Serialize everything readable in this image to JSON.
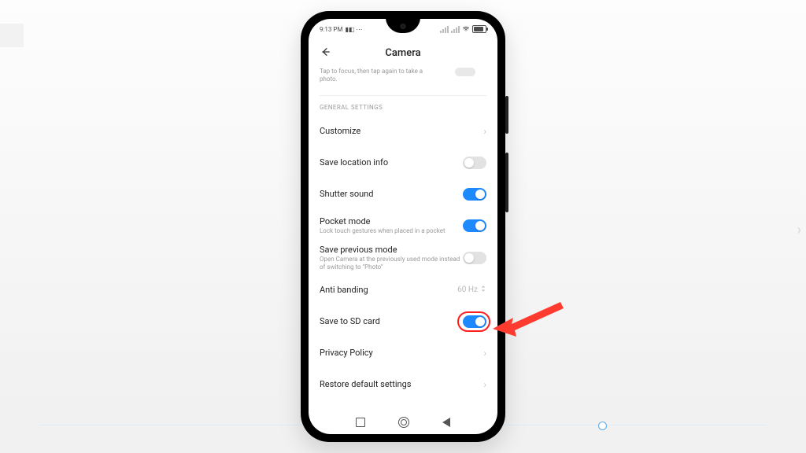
{
  "status": {
    "time": "9:13 PM",
    "icons_left": "▮◧ ⋯"
  },
  "header": {
    "title": "Camera"
  },
  "clipped": {
    "line1": "Tap to focus, then tap again to take a",
    "line2": "photo."
  },
  "section_title": "GENERAL SETTINGS",
  "rows": {
    "customize": {
      "label": "Customize"
    },
    "location": {
      "label": "Save location info",
      "on": false
    },
    "shutter": {
      "label": "Shutter sound",
      "on": true
    },
    "pocket": {
      "label": "Pocket mode",
      "sub": "Lock touch gestures when placed in a pocket",
      "on": true
    },
    "prevmode": {
      "label": "Save previous mode",
      "sub": "Open Camera at the previously used mode instead of switching to \"Photo\"",
      "on": false
    },
    "anti": {
      "label": "Anti banding",
      "value": "60 Hz"
    },
    "sdcard": {
      "label": "Save to SD card",
      "on": true
    },
    "privacy": {
      "label": "Privacy Policy"
    },
    "restore": {
      "label": "Restore default settings"
    }
  },
  "annotation": {
    "highlight_target": "save-to-sd-card-toggle",
    "arrow_color": "#ff3b30"
  }
}
